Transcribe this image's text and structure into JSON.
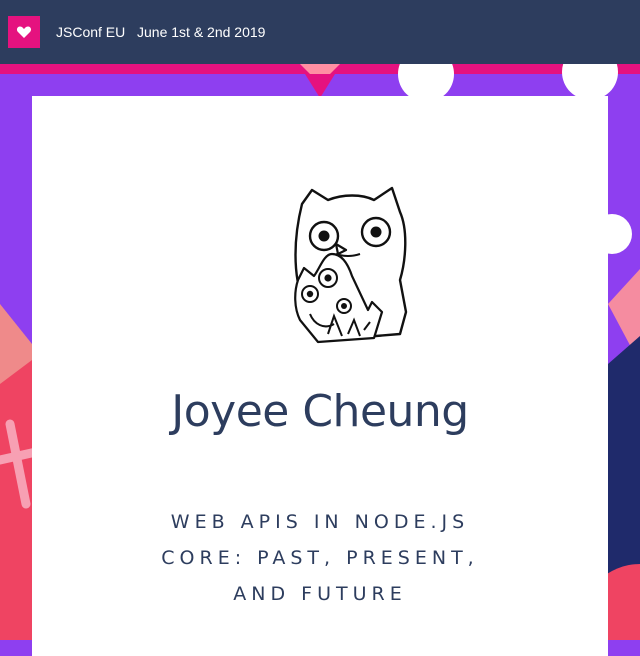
{
  "header": {
    "logo_icon": "heart-icon",
    "event_name": "JSConf EU",
    "event_dates": "June 1st & 2nd 2019"
  },
  "talk": {
    "speaker": "Joyee Cheung",
    "title": "WEB APIS IN NODE.JS CORE: PAST, PRESENT, AND FUTURE",
    "avatar_icon": "cat-drawing-icon"
  },
  "colors": {
    "header_bg": "#2d3d5e",
    "brand_pink": "#e5127f",
    "purple": "#8e3ff0",
    "coral": "#ef4462",
    "navy": "#1f2a6b",
    "text": "#2d3d5e"
  }
}
